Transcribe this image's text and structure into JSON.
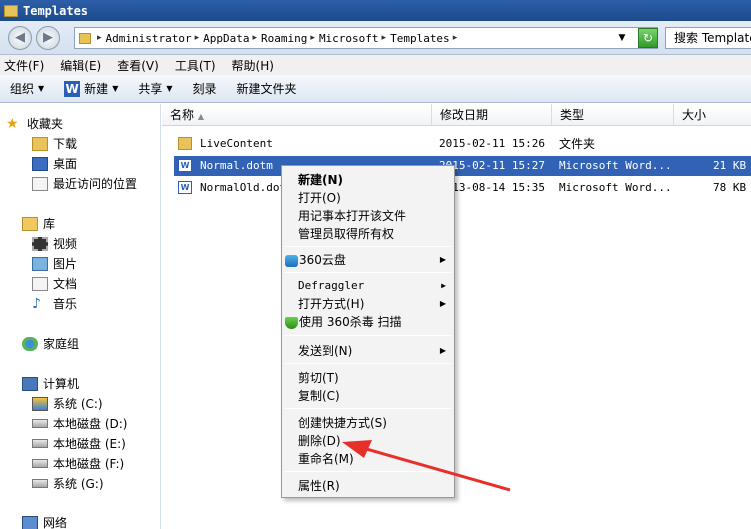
{
  "window": {
    "title": "Templates"
  },
  "address": {
    "crumbs": [
      "Administrator",
      "AppData",
      "Roaming",
      "Microsoft",
      "Templates"
    ],
    "search_placeholder": "搜索 Templates"
  },
  "menubar": [
    "文件(F)",
    "编辑(E)",
    "查看(V)",
    "工具(T)",
    "帮助(H)"
  ],
  "toolbar": {
    "organize": "组织",
    "new": "新建",
    "share": "共享",
    "burn": "刻录",
    "new_folder": "新建文件夹"
  },
  "nav": {
    "favorites": "收藏夹",
    "downloads": "下载",
    "desktop": "桌面",
    "recent": "最近访问的位置",
    "libraries": "库",
    "videos": "视频",
    "pictures": "图片",
    "documents": "文档",
    "music": "音乐",
    "homegroup": "家庭组",
    "computer": "计算机",
    "drives": [
      "系统 (C:)",
      "本地磁盘 (D:)",
      "本地磁盘 (E:)",
      "本地磁盘 (F:)",
      "系统 (G:)"
    ],
    "network": "网络"
  },
  "columns": {
    "name": "名称",
    "modified": "修改日期",
    "type": "类型",
    "size": "大小"
  },
  "files": [
    {
      "name": "LiveContent",
      "modified": "2015-02-11 15:26",
      "type": "文件夹",
      "size": ""
    },
    {
      "name": "Normal.dotm",
      "modified": "2015-02-11 15:27",
      "type": "Microsoft Word...",
      "size": "21 KB"
    },
    {
      "name": "NormalOld.dotm",
      "modified": "2013-08-14 15:35",
      "type": "Microsoft Word...",
      "size": "78 KB"
    }
  ],
  "context_menu": {
    "new": "新建(N)",
    "open": "打开(O)",
    "open_notepad": "用记事本打开该文件",
    "take_ownership": "管理员取得所有权",
    "cloud": "360云盘",
    "defraggler": "Defraggler",
    "open_with": "打开方式(H)",
    "scan": "使用 360杀毒 扫描",
    "send_to": "发送到(N)",
    "cut": "剪切(T)",
    "copy": "复制(C)",
    "create_shortcut": "创建快捷方式(S)",
    "delete": "删除(D)",
    "rename": "重命名(M)",
    "properties": "属性(R)"
  },
  "colors": {
    "selection": "#3162b5",
    "annotation_arrow": "#e8302a"
  }
}
